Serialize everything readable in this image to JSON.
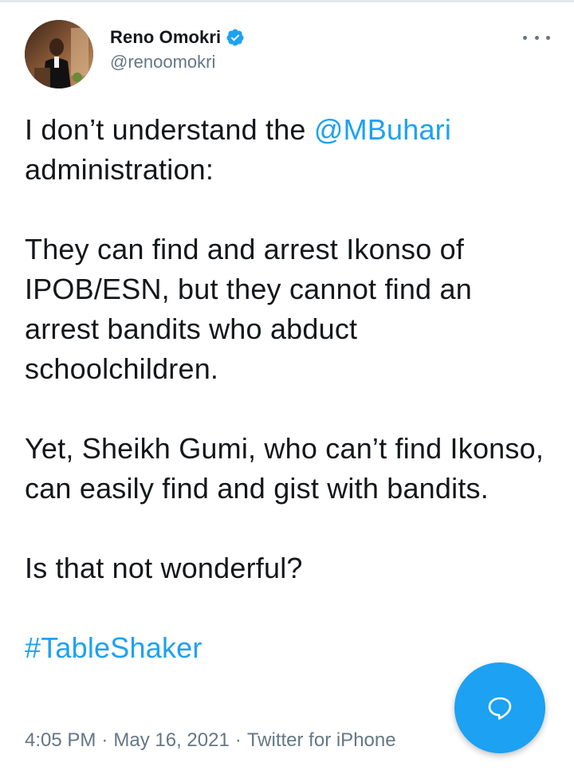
{
  "author": {
    "display_name": "Reno Omokri",
    "handle": "@renoomokri",
    "verified": true,
    "avatar_icon": "profile-photo-speaker-at-podium"
  },
  "tweet": {
    "line1_prefix": "I don’t understand the ",
    "mention": "@MBuhari",
    "line1_suffix": "administration:",
    "para2": "They can find and arrest Ikonso of IPOB/ESN, but they cannot find an arrest bandits who abduct schoolchildren.",
    "para3": "Yet, Sheikh Gumi, who can’t find Ikonso, can easily find and gist with bandits.",
    "para4": "Is that not wonderful?",
    "hashtag": "#TableShaker"
  },
  "meta": {
    "time": "4:05 PM",
    "date": "May 16, 2021",
    "separator": "·",
    "source": "Twitter for iPhone"
  },
  "icons": {
    "more": "more-horizontal-icon",
    "verified": "verified-badge-icon",
    "compose": "reply-bubble-icon"
  },
  "colors": {
    "accent": "#1da1f2",
    "text": "#14171a",
    "secondary": "#657786"
  }
}
